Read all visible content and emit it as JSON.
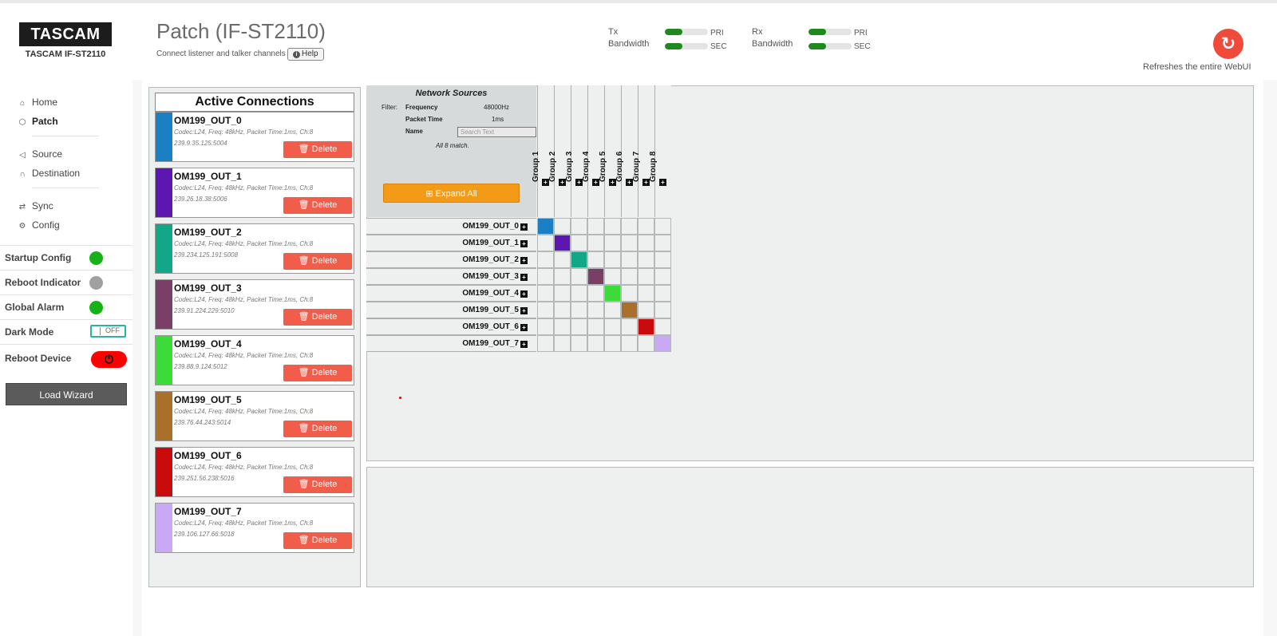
{
  "header": {
    "brand": "TASCAM",
    "device": "TASCAM IF-ST2110",
    "title": "Patch (IF-ST2110)",
    "subtitle": "Connect listener and talker channels",
    "help_label": "Help",
    "tx_label": "Tx",
    "rx_label": "Rx",
    "bandwidth_label": "Bandwidth",
    "pri_label": "PRI",
    "sec_label": "SEC",
    "tx_pri_level": 0.4,
    "tx_sec_level": 0.4,
    "rx_pri_level": 0.4,
    "rx_sec_level": 0.4,
    "refresh_text": "Refreshes the entire WebUI",
    "refresh_icon": "refresh-icon"
  },
  "sidebar": {
    "nav": [
      {
        "label": "Home",
        "icon": "home-icon"
      },
      {
        "label": "Patch",
        "icon": "patch-icon"
      },
      {
        "label": "Source",
        "icon": "speaker-icon"
      },
      {
        "label": "Destination",
        "icon": "headphones-icon"
      },
      {
        "label": "Sync",
        "icon": "sync-icon"
      },
      {
        "label": "Config",
        "icon": "gears-icon"
      }
    ],
    "status": [
      {
        "label": "Startup Config",
        "color": "#17b217"
      },
      {
        "label": "Reboot Indicator",
        "color": "#a0a0a0"
      },
      {
        "label": "Global Alarm",
        "color": "#17b217"
      }
    ],
    "dark_mode_label": "Dark Mode",
    "dark_mode_state": "OFF",
    "reboot_label": "Reboot Device",
    "load_wizard_label": "Load Wizard"
  },
  "active_connections": {
    "title": "Active Connections",
    "delete_label": "Delete",
    "items": [
      {
        "name": "OM199_OUT_0",
        "meta": "Codec:L24, Freq: 48kHz, Packet Time:1ms, Ch:8",
        "addr": "239.9.35.125:5004",
        "color": "#1b7fc4"
      },
      {
        "name": "OM199_OUT_1",
        "meta": "Codec:L24, Freq: 48kHz, Packet Time:1ms, Ch:8",
        "addr": "239.26.18.38:5006",
        "color": "#5d17b0"
      },
      {
        "name": "OM199_OUT_2",
        "meta": "Codec:L24, Freq: 48kHz, Packet Time:1ms, Ch:8",
        "addr": "239.234.125.191:5008",
        "color": "#12a887"
      },
      {
        "name": "OM199_OUT_3",
        "meta": "Codec:L24, Freq: 48kHz, Packet Time:1ms, Ch:8",
        "addr": "239.91.224.229:5010",
        "color": "#7a3f66"
      },
      {
        "name": "OM199_OUT_4",
        "meta": "Codec:L24, Freq: 48kHz, Packet Time:1ms, Ch:8",
        "addr": "239.88.9.124:5012",
        "color": "#3ddb3a"
      },
      {
        "name": "OM199_OUT_5",
        "meta": "Codec:L24, Freq: 48kHz, Packet Time:1ms, Ch:8",
        "addr": "239.76.44.243:5014",
        "color": "#a8702a"
      },
      {
        "name": "OM199_OUT_6",
        "meta": "Codec:L24, Freq: 48kHz, Packet Time:1ms, Ch:8",
        "addr": "239.251.56.238:5016",
        "color": "#c80c0c"
      },
      {
        "name": "OM199_OUT_7",
        "meta": "Codec:L24, Freq: 48kHz, Packet Time:1ms, Ch:8",
        "addr": "239.106.127.66:5018",
        "color": "#c9a8f5"
      }
    ]
  },
  "network_sources": {
    "title": "Network Sources",
    "filter_label": "Filter:",
    "frequency_label": "Frequency",
    "frequency_value": "48000Hz",
    "packet_time_label": "Packet Time",
    "packet_time_value": "1ms",
    "name_label": "Name",
    "search_placeholder": "Search Text",
    "match_text": "All 8 match.",
    "expand_label": "Expand All",
    "groups": [
      "Group 1",
      "Group 2",
      "Group 3",
      "Group 4",
      "Group 5",
      "Group 6",
      "Group 7",
      "Group 8"
    ],
    "rows": [
      "OM199_OUT_0",
      "OM199_OUT_1",
      "OM199_OUT_2",
      "OM199_OUT_3",
      "OM199_OUT_4",
      "OM199_OUT_5",
      "OM199_OUT_6",
      "OM199_OUT_7"
    ]
  }
}
